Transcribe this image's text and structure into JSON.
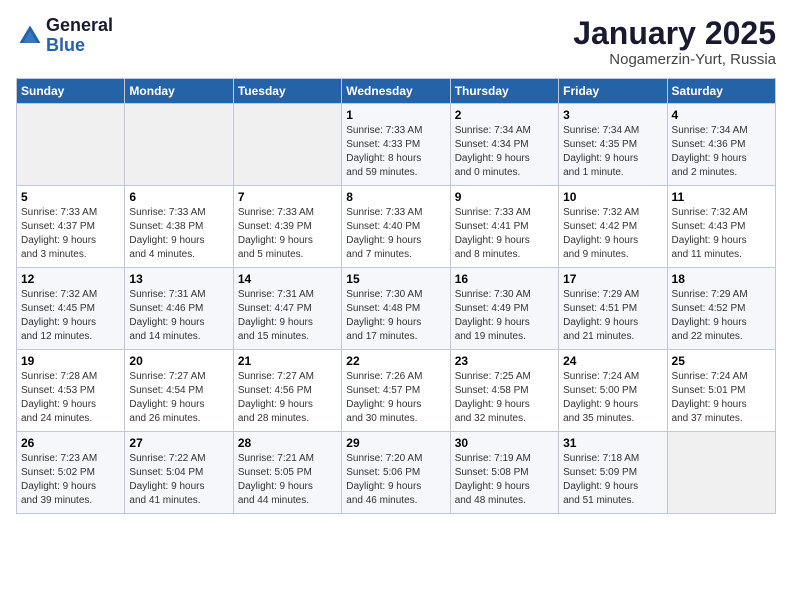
{
  "header": {
    "logo_general": "General",
    "logo_blue": "Blue",
    "month_title": "January 2025",
    "location": "Nogamerzin-Yurt, Russia"
  },
  "weekdays": [
    "Sunday",
    "Monday",
    "Tuesday",
    "Wednesday",
    "Thursday",
    "Friday",
    "Saturday"
  ],
  "weeks": [
    [
      {
        "day": "",
        "info": ""
      },
      {
        "day": "",
        "info": ""
      },
      {
        "day": "",
        "info": ""
      },
      {
        "day": "1",
        "info": "Sunrise: 7:33 AM\nSunset: 4:33 PM\nDaylight: 8 hours\nand 59 minutes."
      },
      {
        "day": "2",
        "info": "Sunrise: 7:34 AM\nSunset: 4:34 PM\nDaylight: 9 hours\nand 0 minutes."
      },
      {
        "day": "3",
        "info": "Sunrise: 7:34 AM\nSunset: 4:35 PM\nDaylight: 9 hours\nand 1 minute."
      },
      {
        "day": "4",
        "info": "Sunrise: 7:34 AM\nSunset: 4:36 PM\nDaylight: 9 hours\nand 2 minutes."
      }
    ],
    [
      {
        "day": "5",
        "info": "Sunrise: 7:33 AM\nSunset: 4:37 PM\nDaylight: 9 hours\nand 3 minutes."
      },
      {
        "day": "6",
        "info": "Sunrise: 7:33 AM\nSunset: 4:38 PM\nDaylight: 9 hours\nand 4 minutes."
      },
      {
        "day": "7",
        "info": "Sunrise: 7:33 AM\nSunset: 4:39 PM\nDaylight: 9 hours\nand 5 minutes."
      },
      {
        "day": "8",
        "info": "Sunrise: 7:33 AM\nSunset: 4:40 PM\nDaylight: 9 hours\nand 7 minutes."
      },
      {
        "day": "9",
        "info": "Sunrise: 7:33 AM\nSunset: 4:41 PM\nDaylight: 9 hours\nand 8 minutes."
      },
      {
        "day": "10",
        "info": "Sunrise: 7:32 AM\nSunset: 4:42 PM\nDaylight: 9 hours\nand 9 minutes."
      },
      {
        "day": "11",
        "info": "Sunrise: 7:32 AM\nSunset: 4:43 PM\nDaylight: 9 hours\nand 11 minutes."
      }
    ],
    [
      {
        "day": "12",
        "info": "Sunrise: 7:32 AM\nSunset: 4:45 PM\nDaylight: 9 hours\nand 12 minutes."
      },
      {
        "day": "13",
        "info": "Sunrise: 7:31 AM\nSunset: 4:46 PM\nDaylight: 9 hours\nand 14 minutes."
      },
      {
        "day": "14",
        "info": "Sunrise: 7:31 AM\nSunset: 4:47 PM\nDaylight: 9 hours\nand 15 minutes."
      },
      {
        "day": "15",
        "info": "Sunrise: 7:30 AM\nSunset: 4:48 PM\nDaylight: 9 hours\nand 17 minutes."
      },
      {
        "day": "16",
        "info": "Sunrise: 7:30 AM\nSunset: 4:49 PM\nDaylight: 9 hours\nand 19 minutes."
      },
      {
        "day": "17",
        "info": "Sunrise: 7:29 AM\nSunset: 4:51 PM\nDaylight: 9 hours\nand 21 minutes."
      },
      {
        "day": "18",
        "info": "Sunrise: 7:29 AM\nSunset: 4:52 PM\nDaylight: 9 hours\nand 22 minutes."
      }
    ],
    [
      {
        "day": "19",
        "info": "Sunrise: 7:28 AM\nSunset: 4:53 PM\nDaylight: 9 hours\nand 24 minutes."
      },
      {
        "day": "20",
        "info": "Sunrise: 7:27 AM\nSunset: 4:54 PM\nDaylight: 9 hours\nand 26 minutes."
      },
      {
        "day": "21",
        "info": "Sunrise: 7:27 AM\nSunset: 4:56 PM\nDaylight: 9 hours\nand 28 minutes."
      },
      {
        "day": "22",
        "info": "Sunrise: 7:26 AM\nSunset: 4:57 PM\nDaylight: 9 hours\nand 30 minutes."
      },
      {
        "day": "23",
        "info": "Sunrise: 7:25 AM\nSunset: 4:58 PM\nDaylight: 9 hours\nand 32 minutes."
      },
      {
        "day": "24",
        "info": "Sunrise: 7:24 AM\nSunset: 5:00 PM\nDaylight: 9 hours\nand 35 minutes."
      },
      {
        "day": "25",
        "info": "Sunrise: 7:24 AM\nSunset: 5:01 PM\nDaylight: 9 hours\nand 37 minutes."
      }
    ],
    [
      {
        "day": "26",
        "info": "Sunrise: 7:23 AM\nSunset: 5:02 PM\nDaylight: 9 hours\nand 39 minutes."
      },
      {
        "day": "27",
        "info": "Sunrise: 7:22 AM\nSunset: 5:04 PM\nDaylight: 9 hours\nand 41 minutes."
      },
      {
        "day": "28",
        "info": "Sunrise: 7:21 AM\nSunset: 5:05 PM\nDaylight: 9 hours\nand 44 minutes."
      },
      {
        "day": "29",
        "info": "Sunrise: 7:20 AM\nSunset: 5:06 PM\nDaylight: 9 hours\nand 46 minutes."
      },
      {
        "day": "30",
        "info": "Sunrise: 7:19 AM\nSunset: 5:08 PM\nDaylight: 9 hours\nand 48 minutes."
      },
      {
        "day": "31",
        "info": "Sunrise: 7:18 AM\nSunset: 5:09 PM\nDaylight: 9 hours\nand 51 minutes."
      },
      {
        "day": "",
        "info": ""
      }
    ]
  ]
}
